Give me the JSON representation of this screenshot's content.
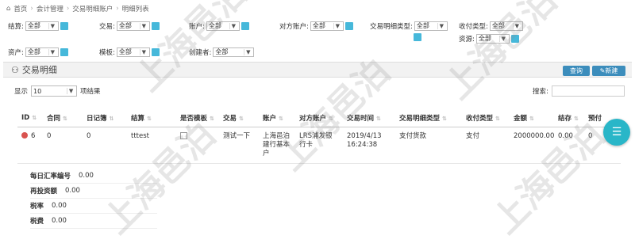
{
  "breadcrumb": {
    "home": "首页",
    "items": [
      "会计管理",
      "交易明细账户",
      "明细列表"
    ]
  },
  "filters": {
    "settlement": {
      "label": "结算:",
      "value": "全部"
    },
    "trade": {
      "label": "交易:",
      "value": "全部"
    },
    "account": {
      "label": "账户:",
      "value": "全部"
    },
    "counter_account": {
      "label": "对方账户:",
      "value": "全部"
    },
    "detail_type": {
      "label": "交易明细类型:",
      "value": "全部"
    },
    "pay_type": {
      "label": "收付类型:",
      "value": "全部"
    },
    "resource": {
      "label": "资源:",
      "value": "全部"
    },
    "asset": {
      "label": "资产:",
      "value": "全部"
    },
    "template": {
      "label": "模板:",
      "value": "全部"
    },
    "creator": {
      "label": "创建者:",
      "value": "全部"
    }
  },
  "panel": {
    "title": "交易明细",
    "query_btn": "查询",
    "new_btn": "新建"
  },
  "table_controls": {
    "show": "显示",
    "page_size": "10",
    "suffix": "项结果",
    "search": "搜索:"
  },
  "columns": [
    "ID",
    "合同",
    "日记簿",
    "结算",
    "是否模板",
    "交易",
    "账户",
    "对方账户",
    "交易时间",
    "交易明细类型",
    "收付类型",
    "金额",
    "结存",
    "预付"
  ],
  "row": {
    "id": "6",
    "contract": "0",
    "journal": "0",
    "settlement": "tttest",
    "trade": "测试一下",
    "account": "上海邑泊建行基本户",
    "counter_account": "LRS浦发银行卡",
    "time": "2019/4/13 16:24:38",
    "detail_type": "支付货款",
    "pay_type": "支付",
    "amount": "2000000.00",
    "balance": "0.00",
    "prepaid": "0"
  },
  "details": [
    {
      "key": "每日汇率编号",
      "value": "0.00"
    },
    {
      "key": "再投资额",
      "value": "0.00"
    },
    {
      "key": "税率",
      "value": "0.00"
    },
    {
      "key": "税费",
      "value": "0.00"
    }
  ],
  "watermark": "上海邑泊",
  "colors": {
    "accent": "#3c8dbc",
    "link": "#46b8da",
    "fab": "#29b6c8",
    "danger": "#d9534f"
  }
}
